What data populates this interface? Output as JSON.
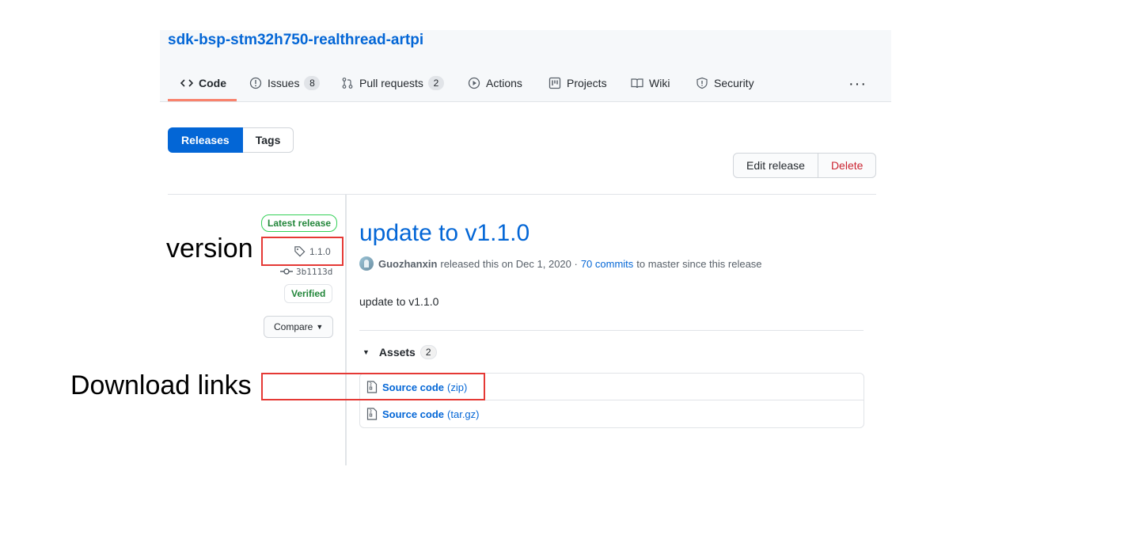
{
  "repo": {
    "title": "sdk-bsp-stm32h750-realthread-artpi"
  },
  "nav": {
    "tabs": [
      {
        "label": "Code"
      },
      {
        "label": "Issues",
        "count": "8"
      },
      {
        "label": "Pull requests",
        "count": "2"
      },
      {
        "label": "Actions"
      },
      {
        "label": "Projects"
      },
      {
        "label": "Wiki"
      },
      {
        "label": "Security"
      }
    ],
    "more": "···",
    "active_tab": "Code",
    "active_color": "#f9826c"
  },
  "toggle": {
    "releases": "Releases",
    "tags": "Tags"
  },
  "actions": {
    "edit": "Edit release",
    "delete": "Delete"
  },
  "sidebar": {
    "latest_label": "Latest release",
    "tag": "1.1.0",
    "commit": "3b1113d",
    "verified": "Verified",
    "compare": "Compare"
  },
  "release": {
    "title": "update to v1.1.0",
    "author": "Guozhanxin",
    "released_text": "released this on Dec 1, 2020 ·",
    "commits_link": "70 commits",
    "commits_suffix": "to master since this release",
    "body": "update to v1.1.0",
    "assets_label": "Assets",
    "assets_count": "2",
    "assets": [
      {
        "name": "Source code",
        "ext": "(zip)"
      },
      {
        "name": "Source code",
        "ext": "(tar.gz)"
      }
    ]
  },
  "annotations": {
    "version": "version",
    "download": "Download links",
    "color": "#e53935"
  },
  "colors": {
    "link": "#0366d6",
    "primary": "#0366d6",
    "danger": "#cb2431",
    "success": "#22863a"
  }
}
